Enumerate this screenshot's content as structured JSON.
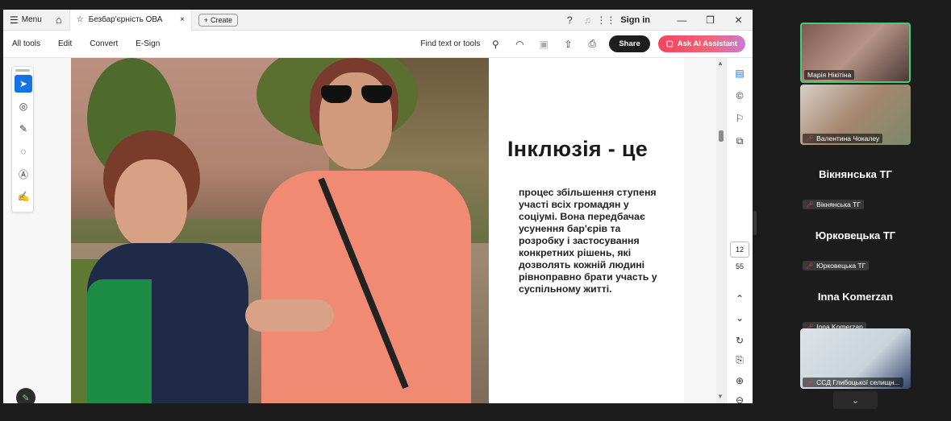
{
  "titlebar": {
    "menu_label": "Menu",
    "tab_title": "Безбар'єрність ОВА",
    "create_label": "Create",
    "sign_in": "Sign in"
  },
  "toolbar": {
    "items": [
      "All tools",
      "Edit",
      "Convert",
      "E-Sign"
    ],
    "find_label": "Find text or tools",
    "share_label": "Share",
    "ai_label": "Ask AI Assistant"
  },
  "slide": {
    "headline": "Інклюзія - це",
    "body": "процес збільшення ступеня участі всіх громадян у соціумі. Вона передбачає усунення бар'єрів та розробку і застосування конкретних рішень, які дозволять кожній людині рівноправно брати участь у суспільному житті."
  },
  "pagination": {
    "current": "12",
    "total": "55"
  },
  "participants": {
    "p1": "Марія Нікітіна",
    "p2": "Валентина Чокалеу",
    "p3_big": "Вікнянська ТГ",
    "p3_small": "Вікнянська ТГ",
    "p4_big": "Юрковецька ТГ",
    "p4_small": "Юрковецька ТГ",
    "p5_big": "Inna Komerzan",
    "p5_small": "Inna Komerzan",
    "p6": "ССД Глибоцької селищн..."
  },
  "colors": {
    "speaking_border": "#3ecf7a",
    "active_tool": "#1473e6",
    "ai_button": "#f25e6d",
    "mic_off": "#e0453b"
  }
}
